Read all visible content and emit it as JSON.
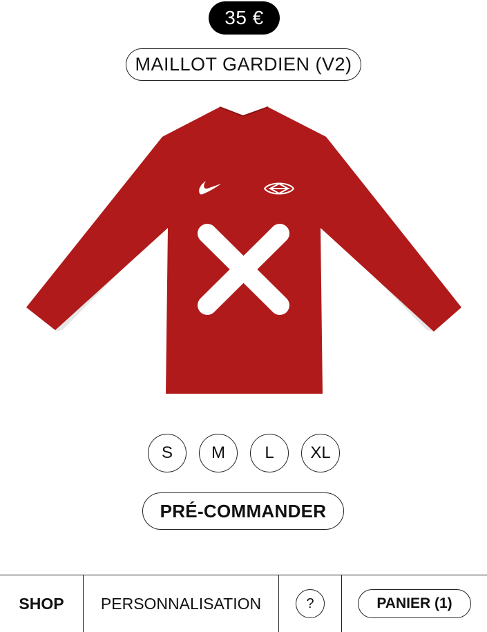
{
  "product": {
    "price": "35 €",
    "name": "MAILLOT GARDIEN (V2)",
    "jersey_color": "#B01A1A"
  },
  "sizes": [
    {
      "label": "S"
    },
    {
      "label": "M"
    },
    {
      "label": "L"
    },
    {
      "label": "XL"
    }
  ],
  "actions": {
    "preorder_label": "PRÉ-COMMANDER"
  },
  "nav": {
    "shop": "SHOP",
    "personalisation": "PERSONNALISATION",
    "help": "?",
    "cart": "PANIER (1)"
  },
  "icons": [
    "swoosh-logo",
    "crest-logo",
    "cross-emblem"
  ]
}
